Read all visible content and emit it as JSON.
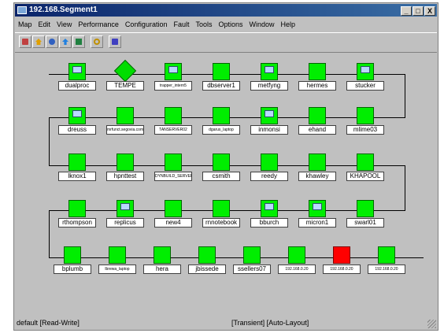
{
  "window": {
    "title": "192.168.Segment1",
    "controls": [
      "_",
      "□",
      "X"
    ]
  },
  "menu": [
    "Map",
    "Edit",
    "View",
    "Performance",
    "Configuration",
    "Fault",
    "Tools",
    "Options",
    "Window",
    "Help"
  ],
  "toolbar": {
    "icons": [
      "map-icon",
      "home-icon",
      "network-icon",
      "up-arrow-icon",
      "pin-icon",
      "search-icon",
      "topology-icon"
    ]
  },
  "rows": [
    [
      {
        "label": "dualproc",
        "kind": "pc"
      },
      {
        "label": "TEMPE",
        "kind": "router"
      },
      {
        "label": "trapper_intern5",
        "kind": "pc"
      },
      {
        "label": "dbserver1",
        "kind": "host"
      },
      {
        "label": "metfyng",
        "kind": "pc"
      },
      {
        "label": "hermes",
        "kind": "host"
      },
      {
        "label": "stucker",
        "kind": "pc"
      }
    ],
    [
      {
        "label": "dreuss",
        "kind": "pc"
      },
      {
        "label": "mrfunct.segovia.com",
        "kind": "host"
      },
      {
        "label": "TANSERVER02",
        "kind": "host"
      },
      {
        "label": "dgarus_laptop",
        "kind": "host"
      },
      {
        "label": "inmonsi",
        "kind": "pc"
      },
      {
        "label": "ehand",
        "kind": "host"
      },
      {
        "label": "mlime03",
        "kind": "host"
      }
    ],
    [
      {
        "label": "lknox1",
        "kind": "host"
      },
      {
        "label": "hpnttest",
        "kind": "host"
      },
      {
        "label": "DYNBUILD_SERVER",
        "kind": "host"
      },
      {
        "label": "csmith",
        "kind": "host"
      },
      {
        "label": "reedy",
        "kind": "host"
      },
      {
        "label": "khawley",
        "kind": "host"
      },
      {
        "label": "KHAPOOL",
        "kind": "host"
      }
    ],
    [
      {
        "label": "rthompson",
        "kind": "host"
      },
      {
        "label": "replicus",
        "kind": "pc"
      },
      {
        "label": "new4",
        "kind": "host"
      },
      {
        "label": "rnnotebook",
        "kind": "host"
      },
      {
        "label": "bburch",
        "kind": "pc"
      },
      {
        "label": "micron1",
        "kind": "pc"
      },
      {
        "label": "swarl01",
        "kind": "host"
      }
    ],
    [
      {
        "label": "bplumb",
        "kind": "host"
      },
      {
        "label": "lbrewa_laptop",
        "kind": "host"
      },
      {
        "label": "hera",
        "kind": "host"
      },
      {
        "label": "jbissede",
        "kind": "host"
      },
      {
        "label": "ssellers07",
        "kind": "host"
      },
      {
        "label": "192.168.0.20",
        "kind": "host"
      },
      {
        "label": "192.168.0.20",
        "kind": "host",
        "status": "red"
      },
      {
        "label": "192.168.0.20",
        "kind": "host"
      }
    ]
  ],
  "status": {
    "left": "default [Read-Write]",
    "right": "[Transient] [Auto-Layout]"
  },
  "colors": {
    "node_ok": "#00ee00",
    "node_fault": "#ff0000",
    "title_bar": "#0a246a",
    "background": "#c0c0c0"
  }
}
